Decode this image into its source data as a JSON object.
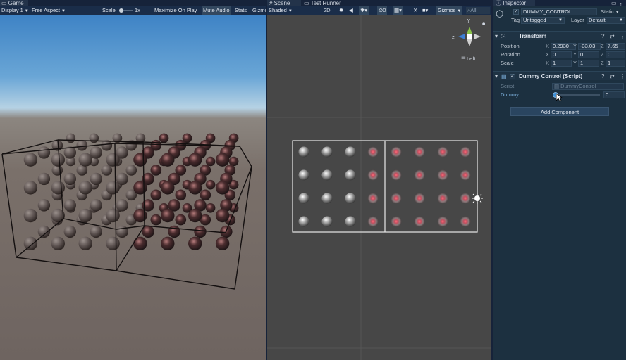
{
  "game": {
    "tab": "Game",
    "display": "Display 1",
    "aspect": "Free Aspect",
    "scale_label": "Scale",
    "scale_value": "1x",
    "maximize": "Maximize On Play",
    "mute": "Mute Audio",
    "stats": "Stats",
    "gizmos": "Gizmo"
  },
  "scene": {
    "tab": "Scene",
    "tab2": "Test Runner",
    "shading": "Shaded",
    "mode_2d": "2D",
    "gizmos": "Gizmos",
    "search": "All",
    "view_label": "Left",
    "axis_y": "y",
    "axis_z": "z"
  },
  "inspector": {
    "tab": "Inspector",
    "object_name": "DUMMY_CONTROL",
    "static_label": "Static",
    "tag_label": "Tag",
    "tag_value": "Untagged",
    "layer_label": "Layer",
    "layer_value": "Default",
    "transform": {
      "title": "Transform",
      "position_label": "Position",
      "rotation_label": "Rotation",
      "scale_label": "Scale",
      "pos": [
        "0.2930",
        "-33.03",
        "7.65"
      ],
      "rot": [
        "0",
        "0",
        "0"
      ],
      "scl": [
        "1",
        "1",
        "1"
      ]
    },
    "dummy": {
      "title": "Dummy Control (Script)",
      "script_label": "Script",
      "script_value": "DummyControl",
      "field_label": "Dummy",
      "field_value": "0"
    },
    "add_component": "Add Component"
  },
  "colors": {
    "accent": "#3d8fd6",
    "panel": "#1c3040",
    "scene_bg": "#474747"
  }
}
